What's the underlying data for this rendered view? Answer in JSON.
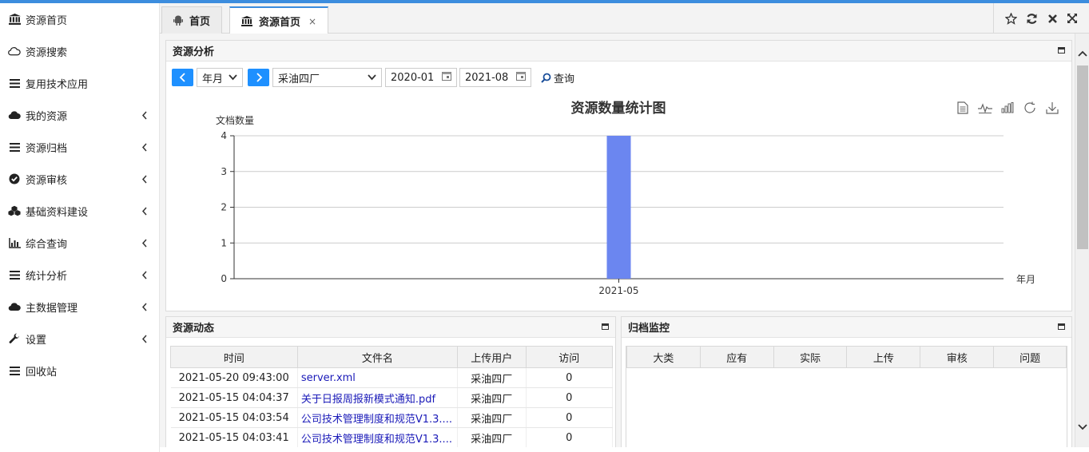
{
  "sidebar": {
    "items": [
      {
        "label": "资源首页",
        "icon": "bank-icon",
        "expandable": false
      },
      {
        "label": "资源搜索",
        "icon": "cloud-outline-icon",
        "expandable": false
      },
      {
        "label": "复用技术应用",
        "icon": "list-icon",
        "expandable": false
      },
      {
        "label": "我的资源",
        "icon": "cloud-icon",
        "expandable": true
      },
      {
        "label": "资源归档",
        "icon": "list-icon",
        "expandable": true
      },
      {
        "label": "资源审核",
        "icon": "check-circle-icon",
        "expandable": true
      },
      {
        "label": "基础资料建设",
        "icon": "cubes-icon",
        "expandable": true
      },
      {
        "label": "综合查询",
        "icon": "bar-chart-icon",
        "expandable": true
      },
      {
        "label": "统计分析",
        "icon": "list-icon",
        "expandable": true
      },
      {
        "label": "主数据管理",
        "icon": "cloud-icon",
        "expandable": true
      },
      {
        "label": "设置",
        "icon": "wrench-icon",
        "expandable": true
      },
      {
        "label": "回收站",
        "icon": "list-icon",
        "expandable": false
      }
    ]
  },
  "tabs": [
    {
      "label": "首页",
      "icon": "android-icon",
      "active": false
    },
    {
      "label": "资源首页",
      "icon": "bank-icon",
      "active": true,
      "close": "×"
    }
  ],
  "analysis": {
    "title": "资源分析",
    "period_select": "年月",
    "unit_select": "采油四厂",
    "date_from": "2020-01",
    "date_to": "2021-08",
    "query_label": "查询"
  },
  "chart_data": {
    "type": "bar",
    "title": "资源数量统计图",
    "ylabel": "文档数量",
    "xlabel": "年月",
    "categories": [
      "2021-05"
    ],
    "values": [
      4
    ],
    "ylim": [
      0,
      4
    ],
    "yticks": [
      0,
      1,
      2,
      3,
      4
    ],
    "grid": true,
    "bar_color": "#6b86f0"
  },
  "activity": {
    "title": "资源动态",
    "columns": [
      "时间",
      "文件名",
      "上传用户",
      "访问"
    ],
    "rows": [
      {
        "time": "2021-05-20 09:43:00",
        "file": "server.xml",
        "user": "采油四厂",
        "visits": "0"
      },
      {
        "time": "2021-05-15 04:04:37",
        "file": "关于日报周报新模式通知.pdf",
        "user": "采油四厂",
        "visits": "0"
      },
      {
        "time": "2021-05-15 04:03:54",
        "file": "公司技术管理制度和规范V1.3....",
        "user": "采油四厂",
        "visits": "0"
      },
      {
        "time": "2021-05-15 04:03:41",
        "file": "公司技术管理制度和规范V1.3....",
        "user": "采油四厂",
        "visits": "0"
      }
    ]
  },
  "monitor": {
    "title": "归档监控",
    "columns": [
      "大类",
      "应有",
      "实际",
      "上传",
      "审核",
      "问题"
    ]
  }
}
